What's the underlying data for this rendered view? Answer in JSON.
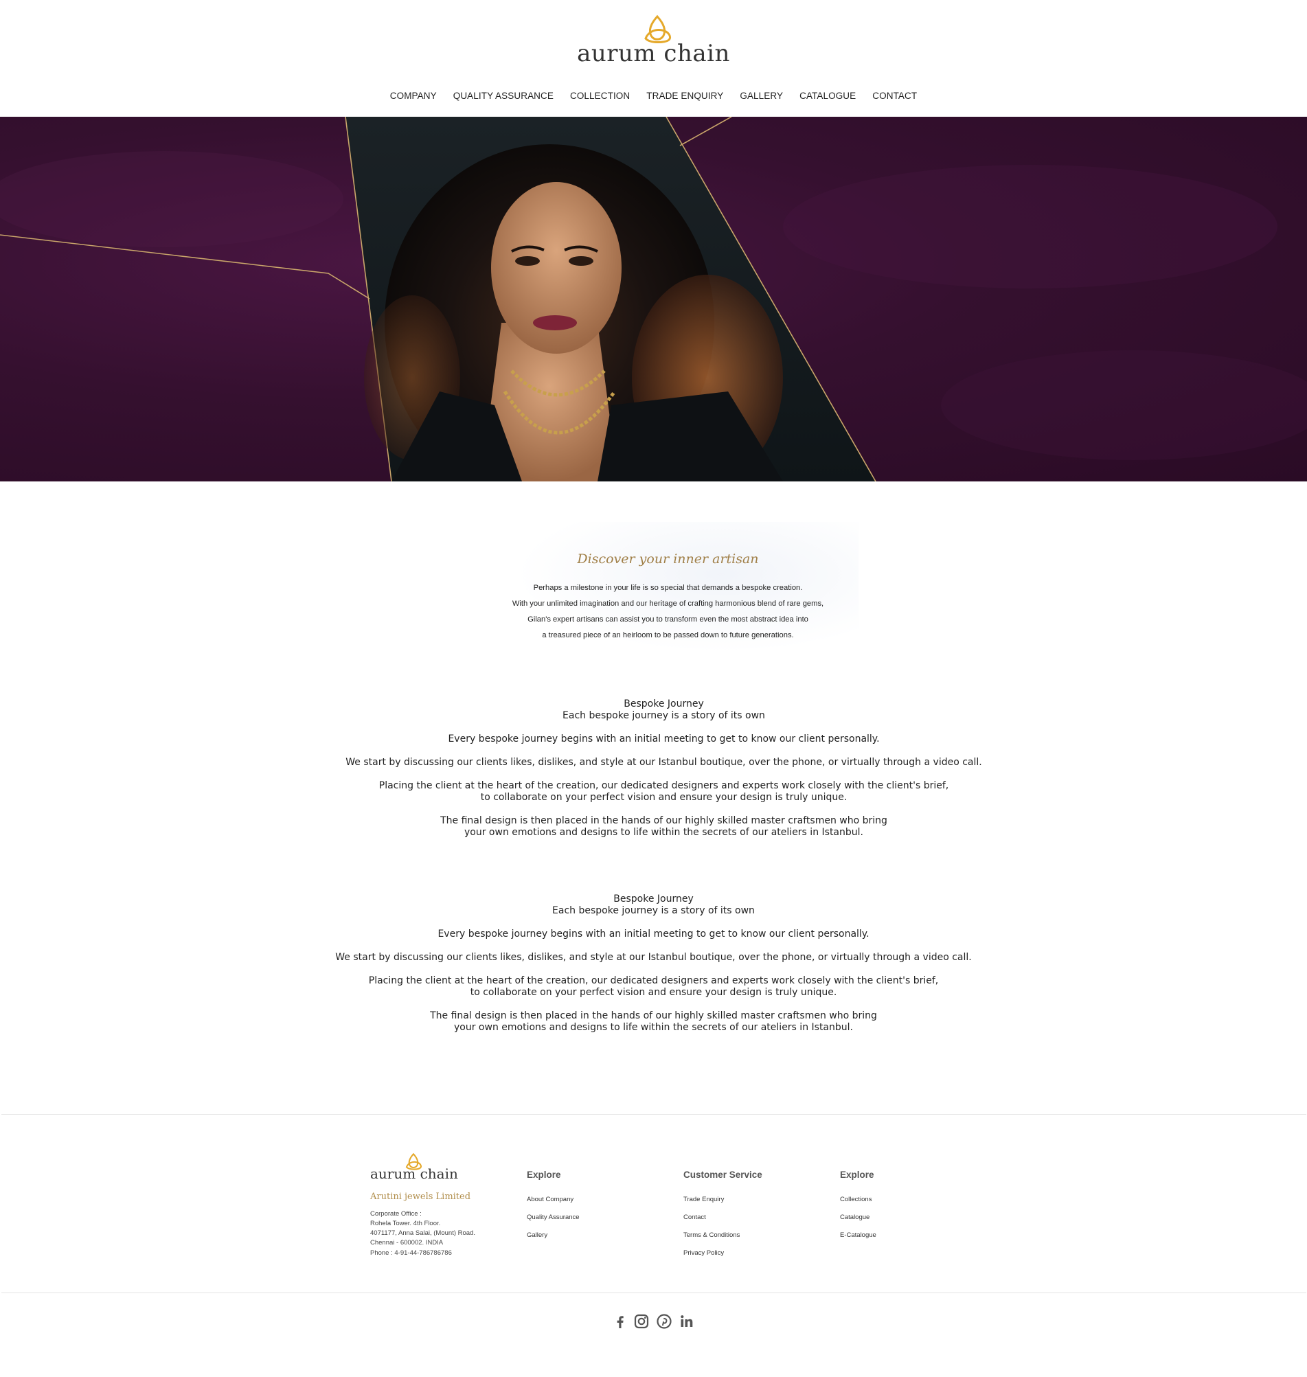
{
  "header": {
    "logo_text": "aurum chain",
    "nav": [
      "COMPANY",
      "QUALITY ASSURANCE",
      "COLLECTION",
      "TRADE ENQUIRY",
      "GALLERY",
      "CATALOGUE",
      "CONTACT"
    ]
  },
  "colors": {
    "gold": "#b08d4a",
    "hero_purple": "#35102f",
    "logo_gold": "#e5a92b"
  },
  "intro": {
    "title": "Discover your inner artisan",
    "lines": [
      "Perhaps a milestone in your life is so special that demands a bespoke creation.",
      "With your unlimited imagination and our heritage of crafting harmonious blend of rare gems,",
      "Gilan's expert artisans can assist you to transform even the most abstract idea into",
      "a treasured piece of an heirloom to be passed down to future generations."
    ]
  },
  "bespoke_blocks": [
    {
      "title": "Bespoke Journey",
      "subtitle": "Each bespoke journey is a story of its own",
      "p1": "Every bespoke journey begins with an initial meeting to get to know our client personally.",
      "p2": "We start by discussing our clients likes, dislikes, and style at our Istanbul boutique, over the phone, or virtually through a video call.",
      "p3a": "Placing the client at the heart of the creation, our dedicated designers and experts work closely with the client's brief,",
      "p3b": "to collaborate on your perfect vision and ensure your design is truly unique.",
      "p4a": "The final design is then placed in the hands of our highly skilled master craftsmen who bring",
      "p4b": "your own emotions and designs to life within the secrets of our ateliers in Istanbul."
    },
    {
      "title": "Bespoke Journey",
      "subtitle": "Each bespoke journey is a story of its own",
      "p1": "Every bespoke journey begins with an initial meeting to get to know our client personally.",
      "p2": "We start by discussing our clients likes, dislikes, and style at our Istanbul boutique, over the phone, or virtually through a video call.",
      "p3a": "Placing the client at the heart of the creation, our dedicated designers and experts work closely with the client's brief,",
      "p3b": "to collaborate on your perfect vision and ensure your design is truly unique.",
      "p4a": "The final design is then placed in the hands of our highly skilled master craftsmen who bring",
      "p4b": "your own emotions and designs to life within the secrets of our ateliers in Istanbul."
    }
  ],
  "footer": {
    "logo_text": "aurum chain",
    "company": "Arutini jewels Limited",
    "address": [
      "Corporate Office :",
      "Rohela Tower. 4th Floor.",
      "4071177, Anna Salai, (Mount) Road.",
      "Chennai - 600002. INDIA",
      "Phone : 4-91-44-786786786"
    ],
    "col1": {
      "heading": "Explore",
      "links": [
        "About Company",
        "Quality Assurance",
        "Gallery"
      ]
    },
    "col2": {
      "heading": "Customer Service",
      "links": [
        "Trade Enquiry",
        "Contact",
        "Terms & Conditions",
        "Privacy Policy"
      ]
    },
    "col3": {
      "heading": "Explore",
      "links": [
        "Collections",
        "Catalogue",
        "E-Catalogue"
      ]
    },
    "social": [
      "facebook-icon",
      "instagram-icon",
      "pinterest-icon",
      "linkedin-icon"
    ]
  }
}
